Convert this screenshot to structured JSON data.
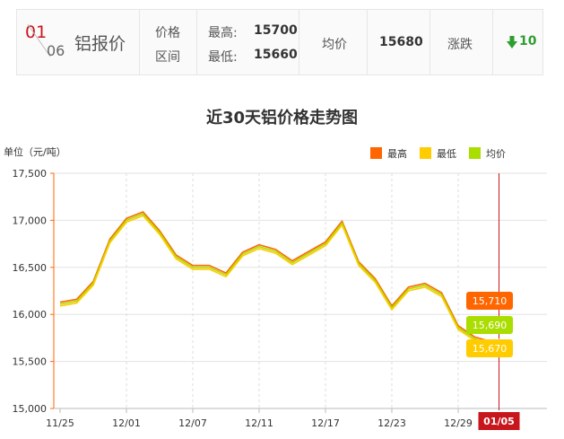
{
  "price_bar": {
    "date_month": "01",
    "date_day": "06",
    "product": "铝报价",
    "price_label": "价格",
    "range_label": "区间",
    "high_label": "最高:",
    "high_value": "15700",
    "low_label": "最低:",
    "low_value": "15660",
    "avg_label": "均价",
    "avg_value": "15680",
    "change_label": "涨跌",
    "change_value": "10",
    "change_direction": "down",
    "change_color": "#2e9e2e"
  },
  "chart_data": {
    "type": "line",
    "title": "近30天铝价格走势图",
    "unit_label": "单位（元/吨）",
    "ylim": [
      15000,
      17500
    ],
    "yticks": [
      "15,000",
      "15,500",
      "16,000",
      "16,500",
      "17,000",
      "17,500"
    ],
    "x_labels": [
      "11/25",
      "12/01",
      "12/07",
      "12/11",
      "12/17",
      "12/23",
      "12/29"
    ],
    "current_x_label": "01/05",
    "legend": [
      {
        "name": "最高",
        "color": "#ff6600"
      },
      {
        "name": "最低",
        "color": "#ffcc00"
      },
      {
        "name": "均价",
        "color": "#aadd00"
      }
    ],
    "series": [
      {
        "name": "最高",
        "color": "#ff6600",
        "values": [
          16130,
          16160,
          16350,
          16800,
          17020,
          17090,
          16890,
          16630,
          16520,
          16520,
          16440,
          16660,
          16740,
          16690,
          16570,
          16670,
          16770,
          16990,
          16560,
          16380,
          16090,
          16290,
          16330,
          16230,
          15880,
          15760,
          15710,
          15705
        ]
      },
      {
        "name": "最低",
        "color": "#ffcc00",
        "values": [
          16090,
          16120,
          16310,
          16760,
          16980,
          17050,
          16850,
          16590,
          16480,
          16480,
          16400,
          16620,
          16700,
          16650,
          16530,
          16630,
          16730,
          16950,
          16520,
          16340,
          16050,
          16250,
          16290,
          16190,
          15840,
          15720,
          15670,
          15665
        ]
      },
      {
        "name": "均价",
        "color": "#aadd00",
        "values": [
          16110,
          16140,
          16330,
          16780,
          17000,
          17070,
          16870,
          16610,
          16500,
          16500,
          16420,
          16640,
          16720,
          16670,
          16550,
          16650,
          16750,
          16970,
          16540,
          16360,
          16070,
          16270,
          16310,
          16210,
          15860,
          15740,
          15690,
          15685
        ]
      }
    ],
    "end_labels": [
      {
        "series": "最高",
        "text": "15,710",
        "color": "#ff6600"
      },
      {
        "series": "均价",
        "text": "15,690",
        "color": "#aadd00"
      },
      {
        "series": "最低",
        "text": "15,670",
        "color": "#ffcc00"
      }
    ],
    "grid": true
  }
}
